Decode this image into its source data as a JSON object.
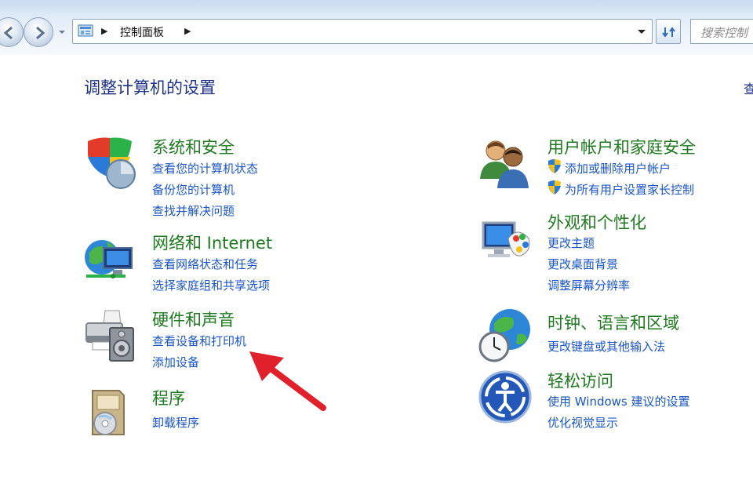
{
  "address_bar": {
    "breadcrumb": "控制面板",
    "search_placeholder": "搜索控制"
  },
  "page": {
    "title": "调整计算机的设置",
    "view_by_fragment": "查"
  },
  "categories": {
    "system_security": {
      "title": "系统和安全",
      "icon": "shield-icon",
      "links": [
        "查看您的计算机状态",
        "备份您的计算机",
        "查找并解决问题"
      ]
    },
    "network": {
      "title": "网络和 Internet",
      "icon": "network-globe-icon",
      "links": [
        "查看网络状态和任务",
        "选择家庭组和共享选项"
      ]
    },
    "hardware_sound": {
      "title": "硬件和声音",
      "icon": "printer-speaker-icon",
      "links": [
        "查看设备和打印机",
        "添加设备"
      ]
    },
    "programs": {
      "title": "程序",
      "icon": "programs-box-icon",
      "links": [
        "卸载程序"
      ]
    },
    "user_accounts": {
      "title": "用户帐户和家庭安全",
      "icon": "users-icon",
      "links": [
        "添加或删除用户帐户",
        "为所有用户设置家长控制"
      ]
    },
    "appearance": {
      "title": "外观和个性化",
      "icon": "monitor-palette-icon",
      "links": [
        "更改主题",
        "更改桌面背景",
        "调整屏幕分辨率"
      ]
    },
    "clock_language": {
      "title": "时钟、语言和区域",
      "icon": "globe-clock-icon",
      "links": [
        "更改键盘或其他输入法"
      ]
    },
    "ease_of_access": {
      "title": "轻松访问",
      "icon": "ease-of-access-icon",
      "links": [
        "使用 Windows 建议的设置",
        "优化视觉显示"
      ]
    }
  },
  "colors": {
    "category_title": "#1e7a1e",
    "link": "#1a55c8",
    "heading": "#1e3287",
    "annotation_arrow": "#e0202a"
  }
}
